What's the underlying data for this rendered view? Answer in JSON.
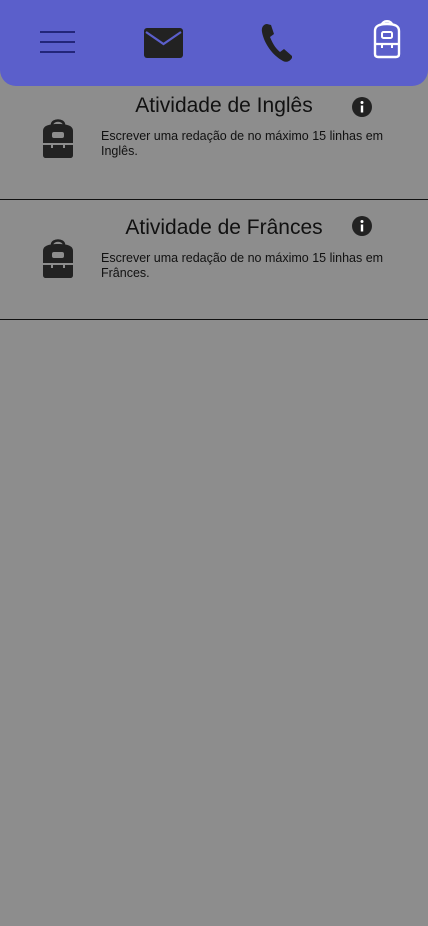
{
  "colors": {
    "background": "#8d8d8d",
    "topbar": "#5b5fcb",
    "icon_dark": "#222222",
    "divider": "#111111"
  },
  "topbar": {
    "icons": [
      "menu-icon",
      "mail-icon",
      "phone-icon",
      "backpack-icon"
    ]
  },
  "activities": [
    {
      "title": "Atividade de Inglês",
      "description": " Escrever uma redação de no máximo 15 linhas em Inglês.",
      "icon": "backpack-icon",
      "info_icon": "info-icon"
    },
    {
      "title": "Atividade de Frânces",
      "description": " Escrever uma redação de no máximo 15 linhas em Frânces.",
      "icon": "backpack-icon",
      "info_icon": "info-icon"
    }
  ]
}
